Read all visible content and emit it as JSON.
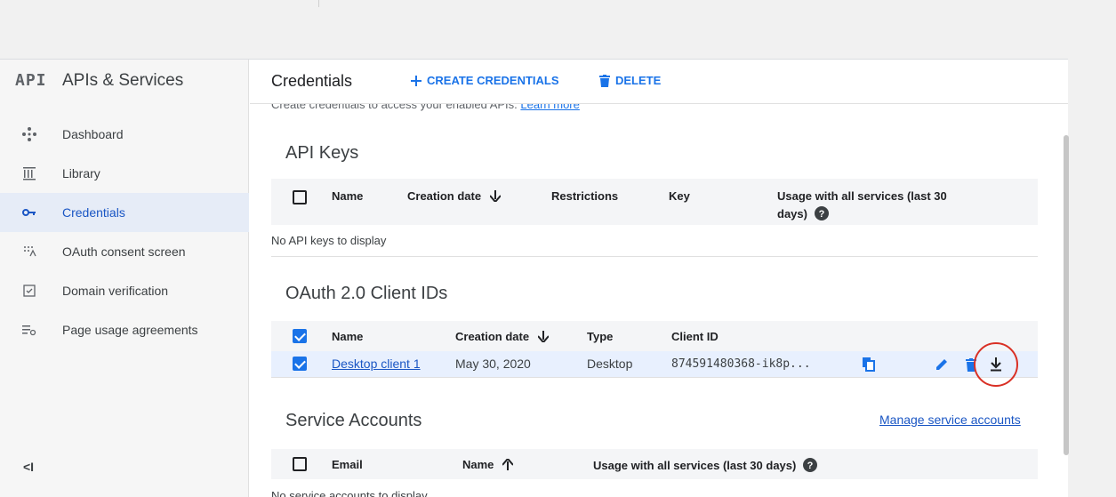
{
  "sidebar": {
    "logo": "API",
    "title": "APIs & Services",
    "items": [
      {
        "label": "Dashboard",
        "icon": "dashboard-icon"
      },
      {
        "label": "Library",
        "icon": "library-icon"
      },
      {
        "label": "Credentials",
        "icon": "key-icon",
        "active": true
      },
      {
        "label": "OAuth consent screen",
        "icon": "oauth-consent-icon"
      },
      {
        "label": "Domain verification",
        "icon": "domain-verification-icon"
      },
      {
        "label": "Page usage agreements",
        "icon": "page-usage-icon"
      }
    ],
    "collapse_label": "<I"
  },
  "header": {
    "title": "Credentials",
    "create_label": "CREATE CREDENTIALS",
    "delete_label": "DELETE"
  },
  "content": {
    "description": "Create credentials to access your enabled APIs.",
    "learn_more": "Learn more",
    "api_keys": {
      "title": "API Keys",
      "columns": [
        "Name",
        "Creation date",
        "Restrictions",
        "Key",
        "Usage with all services (last 30",
        "days)"
      ],
      "empty": "No API keys to display"
    },
    "oauth": {
      "title": "OAuth 2.0 Client IDs",
      "columns": [
        "Name",
        "Creation date",
        "Type",
        "Client ID"
      ],
      "rows": [
        {
          "name": "Desktop client 1",
          "date": "May 30, 2020",
          "type": "Desktop",
          "client_id": "874591480368-ik8p..."
        }
      ]
    },
    "service_accounts": {
      "title": "Service Accounts",
      "manage_link": "Manage service accounts",
      "columns": [
        "Email",
        "Name",
        "Usage with all services (last 30 days)"
      ],
      "empty": "No service accounts to display"
    }
  },
  "colors": {
    "accent": "#1a73e8",
    "highlight": "#d93025"
  }
}
